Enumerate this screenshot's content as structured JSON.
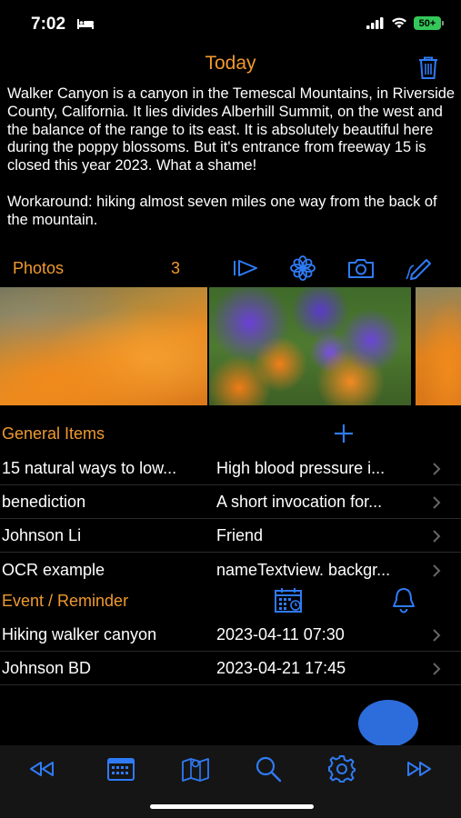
{
  "status_bar": {
    "time": "7:02",
    "battery": "50+"
  },
  "nav": {
    "title": "Today"
  },
  "note": {
    "text": "Walker Canyon is a canyon in the Temescal Mountains, in Riverside County, California. It lies divides Alberhill Summit, on the west and the balance of the range to its east. It is absolutely beautiful here during the poppy blossoms. But it's entrance from freeway 15 is closed this year 2023. What a shame!\n\nWorkaround: hiking almost seven miles one way from the back of the mountain."
  },
  "photos": {
    "label": "Photos",
    "count": "3"
  },
  "general_items": {
    "label": "General Items",
    "rows": [
      {
        "title": "15 natural ways to low...",
        "detail": "High blood pressure i..."
      },
      {
        "title": "benediction",
        "detail": "A short invocation for..."
      },
      {
        "title": "Johnson Li",
        "detail": "Friend"
      },
      {
        "title": "OCR example",
        "detail": "nameTextview. backgr..."
      }
    ]
  },
  "events": {
    "label": "Event / Reminder",
    "rows": [
      {
        "title": "Hiking walker canyon",
        "detail": "2023-04-11 07:30"
      },
      {
        "title": "Johnson BD",
        "detail": "2023-04-21 17:45"
      }
    ]
  },
  "colors": {
    "accent": "#f09a2e",
    "icon_blue": "#2f7bf5",
    "fab": "#2d6ddb",
    "background": "#000000"
  },
  "icons": [
    "trash-icon",
    "slideshow-icon",
    "flower-icon",
    "camera-icon",
    "pen-icon",
    "plus-icon",
    "calendar-icon",
    "bell-icon",
    "rewind-icon",
    "book-map-icon",
    "search-icon",
    "gear-icon",
    "fast-forward-icon"
  ]
}
